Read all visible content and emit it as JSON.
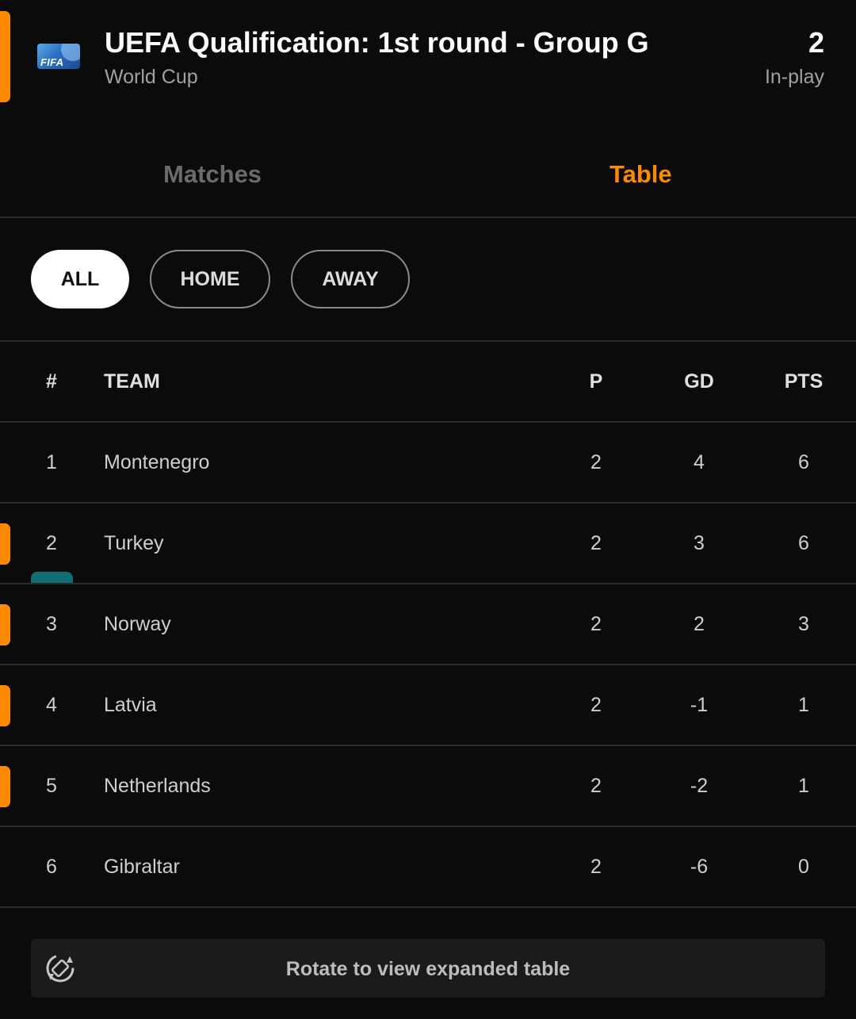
{
  "header": {
    "logo_text": "FIFA",
    "title": "UEFA Qualification: 1st round - Group G",
    "subtitle": "World Cup",
    "count": "2",
    "status": "In-play"
  },
  "tabs": [
    {
      "label": "Matches",
      "active": false
    },
    {
      "label": "Table",
      "active": true
    }
  ],
  "filters": [
    {
      "label": "ALL",
      "active": true
    },
    {
      "label": "HOME",
      "active": false
    },
    {
      "label": "AWAY",
      "active": false
    }
  ],
  "table": {
    "headers": {
      "rank": "#",
      "team": "TEAM",
      "played": "P",
      "gd": "GD",
      "pts": "PTS"
    },
    "rows": [
      {
        "rank": "1",
        "team": "Montenegro",
        "played": "2",
        "gd": "4",
        "pts": "6",
        "live": false
      },
      {
        "rank": "2",
        "team": "Turkey",
        "played": "2",
        "gd": "3",
        "pts": "6",
        "live": true
      },
      {
        "rank": "3",
        "team": "Norway",
        "played": "2",
        "gd": "2",
        "pts": "3",
        "live": true
      },
      {
        "rank": "4",
        "team": "Latvia",
        "played": "2",
        "gd": "-1",
        "pts": "1",
        "live": true
      },
      {
        "rank": "5",
        "team": "Netherlands",
        "played": "2",
        "gd": "-2",
        "pts": "1",
        "live": true
      },
      {
        "rank": "6",
        "team": "Gibraltar",
        "played": "2",
        "gd": "-6",
        "pts": "0",
        "live": false
      }
    ]
  },
  "rotate_banner": {
    "icon": "screen-rotation-icon",
    "text": "Rotate to view expanded table"
  },
  "colors": {
    "accent": "#ff8a00",
    "background": "#0b0b0b",
    "teal": "#0f6e73"
  }
}
